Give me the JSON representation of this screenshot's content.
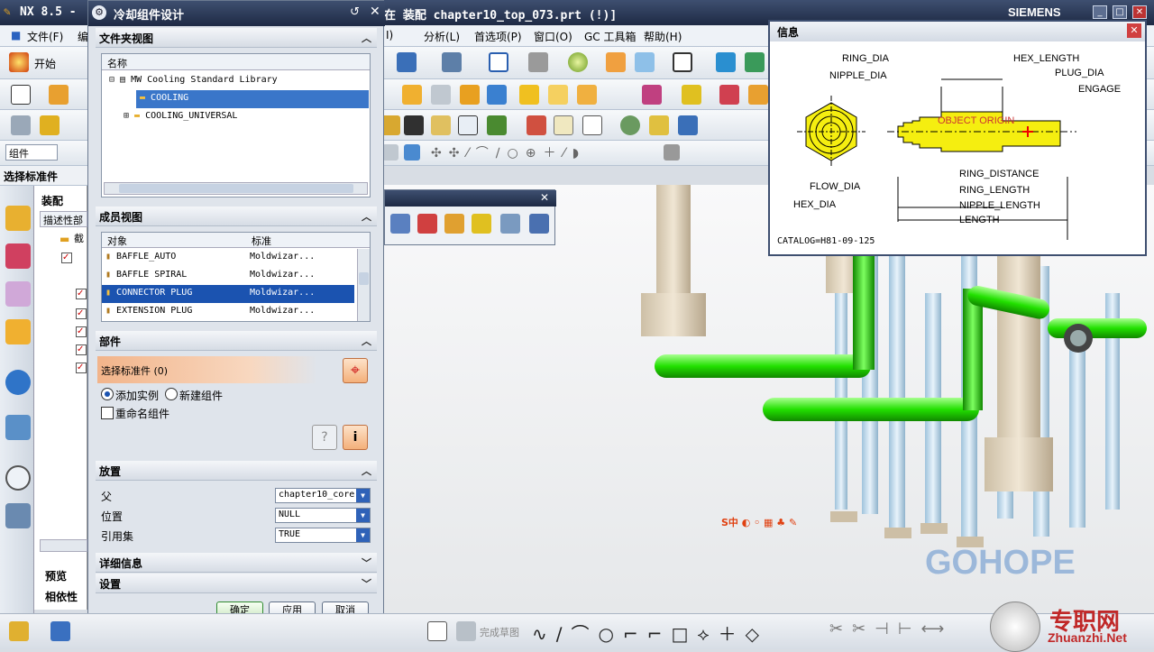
{
  "app": {
    "title_left": "NX 8.5 -",
    "title_right": "在 装配 chapter10_top_073.prt   (!)]",
    "brand": "SIEMENS"
  },
  "menu": [
    {
      "label": "文件(F)"
    },
    {
      "label": "编"
    },
    {
      "label": "I)"
    },
    {
      "label": "分析(L)"
    },
    {
      "label": "首选项(P)"
    },
    {
      "label": "窗口(O)"
    },
    {
      "label": "GC 工具箱"
    },
    {
      "label": "帮助(H)"
    }
  ],
  "left": {
    "start_label": "开始",
    "filter_value": "组件",
    "select_std_part": "选择标准件",
    "tree_header": "装配",
    "tree_col": "描述性部",
    "tree_item": "截",
    "preview": "预览",
    "dependency": "相依性"
  },
  "dialog": {
    "title": "冷却组件设计",
    "folder_view": {
      "header": "文件夹视图",
      "col_name": "名称",
      "items": [
        {
          "label": "MW Cooling Standard Library"
        },
        {
          "label": "COOLING"
        },
        {
          "label": "COOLING_UNIVERSAL"
        }
      ]
    },
    "member_view": {
      "header": "成员视图",
      "col_object": "对象",
      "col_standard": "标准",
      "rows": [
        {
          "name": "BAFFLE_AUTO",
          "std": "Moldwizar..."
        },
        {
          "name": "BAFFLE SPIRAL",
          "std": "Moldwizar..."
        },
        {
          "name": "CONNECTOR PLUG",
          "std": "Moldwizar..."
        },
        {
          "name": "EXTENSION PLUG",
          "std": "Moldwizar..."
        }
      ]
    },
    "part": {
      "header": "部件",
      "select_label": "选择标准件 (0)",
      "radio_add": "添加实例",
      "radio_new": "新建组件",
      "rename_label": "重命名组件"
    },
    "placement": {
      "header": "放置",
      "parent_label": "父",
      "parent_value": "chapter10_core",
      "position_label": "位置",
      "position_value": "NULL",
      "refset_label": "引用集",
      "refset_value": "TRUE"
    },
    "details_header": "详细信息",
    "settings_header": "设置",
    "ok": "确定",
    "apply": "应用",
    "cancel": "取消"
  },
  "info": {
    "title": "信息",
    "labels": {
      "ring_dia": "RING_DIA",
      "nipple_dia": "NIPPLE_DIA",
      "hex_length": "HEX_LENGTH",
      "plug_dia": "PLUG_DIA",
      "engage": "ENGAGE",
      "object_origin": "OBJECT ORIGIN",
      "ring_distance": "RING_DISTANCE",
      "flow_dia": "FLOW_DIA",
      "ring_length": "RING_LENGTH",
      "hex_dia": "HEX_DIA",
      "nipple_length": "NIPPLE_LENGTH",
      "length": "LENGTH"
    },
    "catalog": "CATALOG=H81-09-125"
  },
  "status": {
    "finish_sketch": "完成草图"
  },
  "watermark": {
    "logo": "GOHOPE",
    "site_cn": "专职网",
    "site": "Zhuanzhi.Net"
  },
  "colors": {
    "pipe": "#22e000",
    "selection": "#3a76c9",
    "part_band": "#f2b48a",
    "drawing_fill": "#f5ee10"
  }
}
